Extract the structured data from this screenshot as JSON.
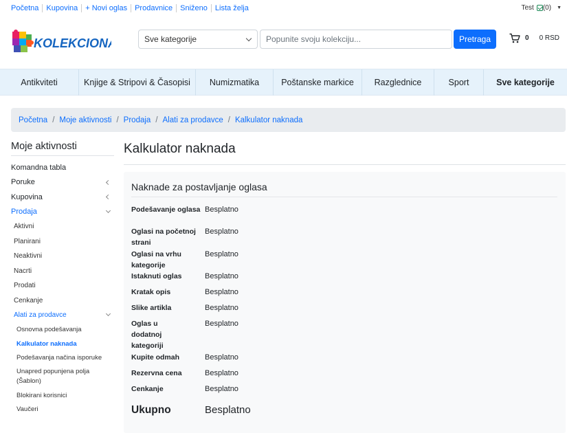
{
  "topbar": {
    "links": [
      "Početna",
      "Kupovina",
      "+ Novi oglas",
      "Prodavnice",
      "Sniženo",
      "Lista želja"
    ],
    "user": "Test",
    "notification_count": "(0)"
  },
  "header": {
    "logo_text": "KOLEKCIONARI",
    "category_select": "Sve kategorije",
    "search_placeholder": "Popunite svoju kolekciju...",
    "search_button": "Pretraga",
    "cart_count": "0",
    "cart_total": "0 RSD"
  },
  "category_nav": [
    "Antikviteti",
    "Knjige & Stripovi & Časopisi",
    "Numizmatika",
    "Poštanske markice",
    "Razglednice",
    "Sport",
    "Sve kategorije"
  ],
  "breadcrumb": [
    "Početna",
    "Moje aktivnosti",
    "Prodaja",
    "Alati za prodavce",
    "Kalkulator naknada"
  ],
  "sidebar": {
    "title": "Moje aktivnosti",
    "dashboard": "Komandna tabla",
    "messages": "Poruke",
    "buying": "Kupovina",
    "selling": "Prodaja",
    "selling_items": [
      "Aktivni",
      "Planirani",
      "Neaktivni",
      "Nacrti",
      "Prodati",
      "Cenkanje"
    ],
    "seller_tools": "Alati za prodavce",
    "seller_tools_items": [
      "Osnovna podešavanja",
      "Kalkulator naknada",
      "Podešavanja načina isporuke",
      "Unapred popunjena polja (Šablon)",
      "Blokirani korisnici",
      "Vaučeri"
    ]
  },
  "main": {
    "title": "Kalkulator naknada",
    "card_title": "Naknade za postavljanje oglasa",
    "fees": [
      {
        "label": "Podešavanje oglasa",
        "value": "Besplatno"
      },
      {
        "label": "Oglasi na početnoj strani",
        "value": "Besplatno"
      },
      {
        "label": "Oglasi na vrhu kategorije",
        "value": "Besplatno"
      },
      {
        "label": "Istaknuti oglas",
        "value": "Besplatno"
      },
      {
        "label": "Kratak opis",
        "value": "Besplatno"
      },
      {
        "label": "Slike artikla",
        "value": "Besplatno"
      },
      {
        "label": "Oglas u dodatnoj kategoriji",
        "value": "Besplatno"
      },
      {
        "label": "Kupite odmah",
        "value": "Besplatno"
      },
      {
        "label": "Rezervna cena",
        "value": "Besplatno"
      },
      {
        "label": "Cenkanje",
        "value": "Besplatno"
      }
    ],
    "total_label": "Ukupno",
    "total_value": "Besplatno"
  },
  "colors": {
    "accent": "#0d6efd",
    "nav_background": "#e6f2fb",
    "breadcrumb_background": "#e9ecef",
    "card_background": "#f8f9fa"
  }
}
